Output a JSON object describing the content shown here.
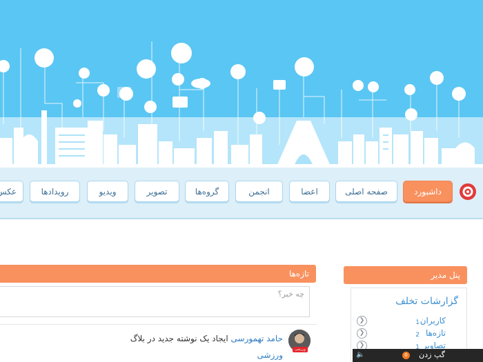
{
  "nav": {
    "tabs": [
      {
        "label": "داشبورد",
        "active": true
      },
      {
        "label": "صفحه اصلی"
      },
      {
        "label": "اعضا"
      },
      {
        "label": "انجمن"
      },
      {
        "label": "گروه‌ها"
      },
      {
        "label": "تصویر"
      },
      {
        "label": "ویدیو"
      },
      {
        "label": "رویدادها"
      },
      {
        "label": "عکس"
      }
    ]
  },
  "admin_panel": {
    "title": "پنل مدیر",
    "reports_title": "گزارشات تخلف",
    "reports": [
      {
        "label": "کاربران",
        "count": "1"
      },
      {
        "label": "تازه‌ها",
        "count": "2"
      },
      {
        "label": "تصاویر",
        "count": "1"
      }
    ]
  },
  "feed": {
    "title": "تازه‌ها",
    "post_placeholder": "چه خبر؟",
    "items": [
      {
        "author": "حامد تهمورسی",
        "action": "ایجاد یک نوشته جدید در بلاگ",
        "tag": "ورزشی",
        "avatar_badge": "ورزشی"
      }
    ]
  },
  "chat": {
    "label": "گپ زدن",
    "count": "0"
  },
  "colors": {
    "banner": "#5ac6f3",
    "accent": "#f9915f",
    "link": "#2e7bc4"
  }
}
